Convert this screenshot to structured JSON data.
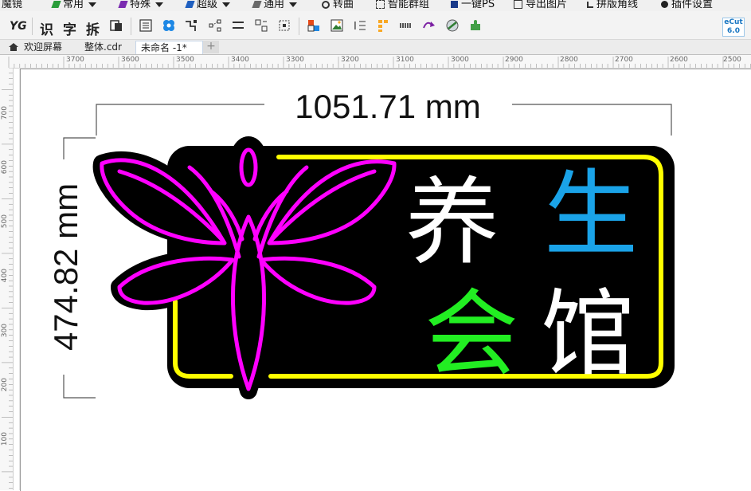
{
  "menu": {
    "left_label": "魔镜",
    "items": [
      {
        "label": "常用",
        "icon": "pen-icon",
        "color": "#2a9d3a",
        "dropdown": true
      },
      {
        "label": "特殊",
        "icon": "pen-icon",
        "color": "#7a2bb0",
        "dropdown": true
      },
      {
        "label": "超级",
        "icon": "pen-icon",
        "color": "#1f5fbf",
        "dropdown": true
      },
      {
        "label": "通用",
        "icon": "pen-icon",
        "color": "#6a6a6a",
        "dropdown": true
      },
      {
        "label": "转曲",
        "icon": "curve-icon",
        "color": "#333333",
        "dropdown": false
      },
      {
        "label": "智能群组",
        "icon": "group-icon",
        "color": "#333333",
        "dropdown": false
      },
      {
        "label": "一键PS",
        "icon": "ps-icon",
        "color": "#1a3a8a",
        "dropdown": false
      },
      {
        "label": "导出图片",
        "icon": "image-icon",
        "color": "#333333",
        "dropdown": false
      },
      {
        "label": "拼版角线",
        "icon": "cropmark-icon",
        "color": "#333333",
        "dropdown": false
      },
      {
        "label": "插件设置",
        "icon": "gear-icon",
        "color": "#222222",
        "dropdown": false
      }
    ]
  },
  "toolbar": {
    "logo": "YG",
    "text_tools": [
      "识",
      "字",
      "拆"
    ],
    "version_top": "eCut",
    "version": "6.0"
  },
  "tabs": [
    {
      "label": "欢迎屏幕",
      "icon": "home-icon",
      "active": false
    },
    {
      "label": "整体.cdr",
      "active": false
    },
    {
      "label": "未命名 -1*",
      "active": true
    }
  ],
  "ruler_h": [
    "3700",
    "3600",
    "3500",
    "3400",
    "3300",
    "3200",
    "3100",
    "3000",
    "2900",
    "2800",
    "2700",
    "2600",
    "2500"
  ],
  "ruler_v": [
    "700",
    "600",
    "500",
    "400",
    "300",
    "200",
    "100"
  ],
  "dimensions": {
    "width_label": "1051.71 mm",
    "height_label": "474.82 mm"
  },
  "sign": {
    "chars": [
      {
        "text": "养",
        "color": "#ffffff"
      },
      {
        "text": "生",
        "color": "#1aa3e8"
      },
      {
        "text": "会",
        "color": "#22ee22"
      },
      {
        "text": "馆",
        "color": "#ffffff"
      }
    ],
    "frame_color": "#ffff00",
    "flower_color": "#ff00ff",
    "background": "#000000"
  }
}
